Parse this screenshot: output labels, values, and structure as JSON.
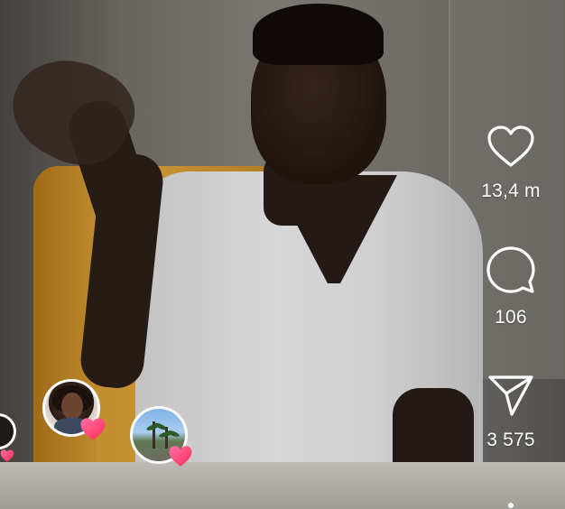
{
  "actions": {
    "like": {
      "icon": "heart-outline-icon",
      "count": "13,4 m"
    },
    "comment": {
      "icon": "speech-bubble-icon",
      "count": "106"
    },
    "share": {
      "icon": "paper-plane-icon",
      "count": "3 575"
    },
    "more": {
      "icon": "more-dots-icon"
    }
  },
  "reactions": [
    {
      "icon": "heart-reaction-icon"
    },
    {
      "icon": "heart-reaction-icon"
    },
    {
      "icon": "heart-reaction-icon"
    }
  ],
  "colors": {
    "icon_white": "#ffffff",
    "heart_gradient_start": "#ff5fa0",
    "heart_gradient_end": "#ff2d55",
    "chair": "#e4a83b",
    "shirt": "#f5f5f5"
  }
}
